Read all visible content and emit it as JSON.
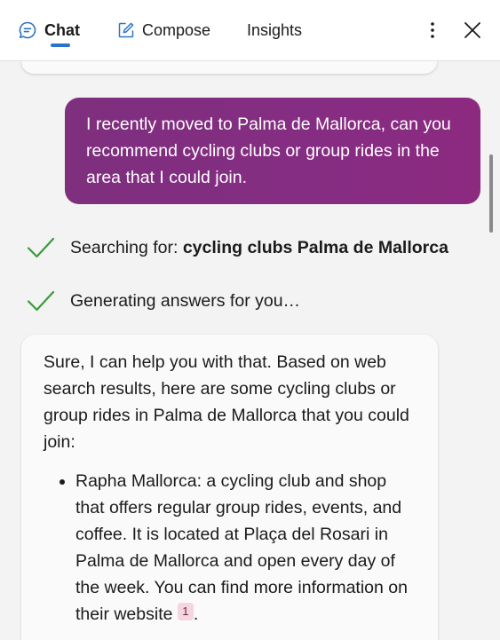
{
  "header": {
    "tabs": [
      {
        "label": "Chat",
        "icon": "chat-bubble-icon",
        "active": true
      },
      {
        "label": "Compose",
        "icon": "compose-icon",
        "active": false
      },
      {
        "label": "Insights",
        "active": false
      }
    ],
    "accent_color": "#2b73c9"
  },
  "conversation": {
    "user_message": "I recently moved to Palma de Mallorca, can you recommend cycling clubs or group rides in the area that I could join.",
    "user_bubble_color": "#852d82",
    "status": [
      {
        "prefix": "Searching for: ",
        "query": "cycling clubs Palma de Mallorca",
        "icon": "checkmark-icon"
      },
      {
        "text": "Generating answers for you…",
        "icon": "checkmark-icon"
      }
    ],
    "check_color": "#3a9a3a",
    "answer": {
      "intro": "Sure, I can help you with that. Based on web search results, here are some cycling clubs or group rides in Palma de Mallorca that you could join:",
      "items": [
        {
          "text": "Rapha Mallorca: a cycling club and shop that offers regular group rides, events, and coffee. It is located at Plaça del Rosari in Palma de Mallorca and open every day of the week. You can find more information on their website",
          "citation": "1",
          "suffix": "."
        }
      ]
    }
  }
}
